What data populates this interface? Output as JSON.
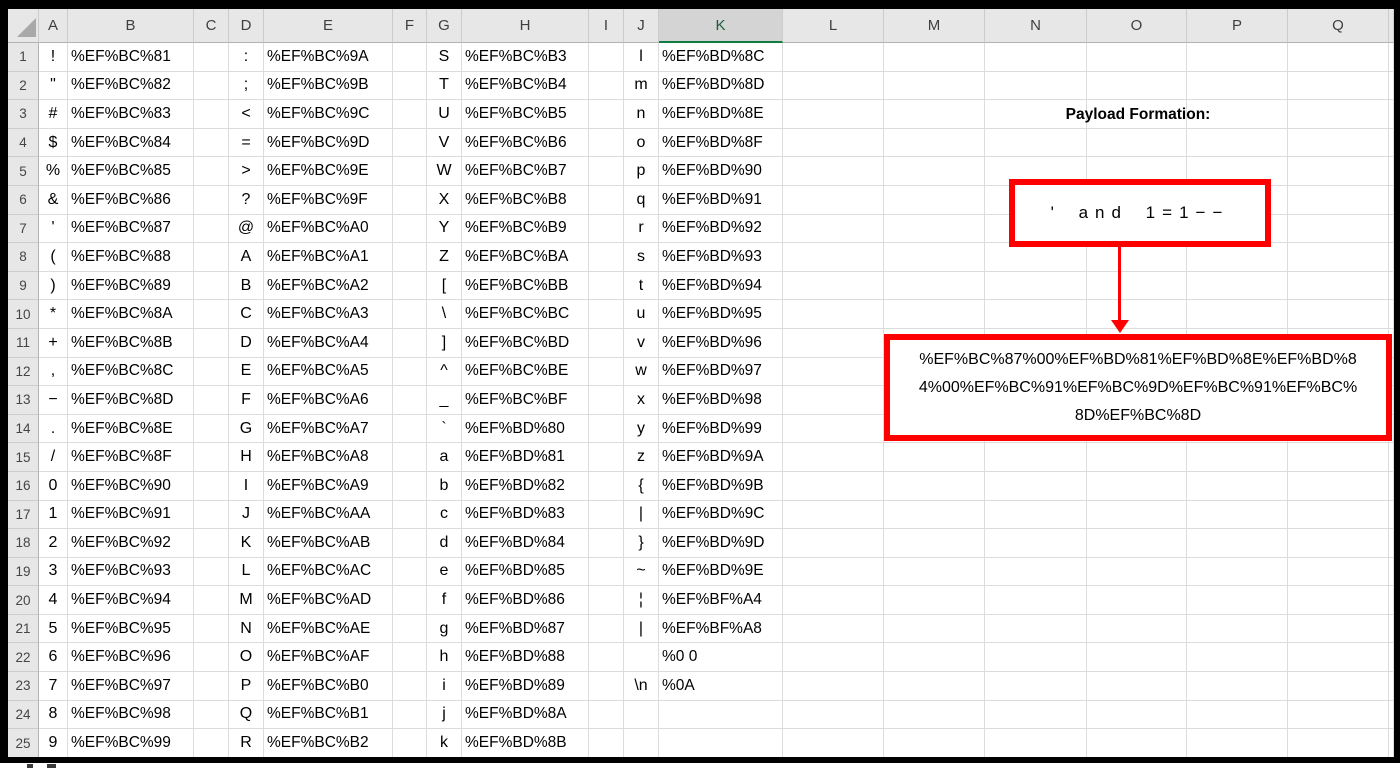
{
  "sheet": {
    "column_headers": [
      "A",
      "B",
      "C",
      "D",
      "E",
      "F",
      "G",
      "H",
      "I",
      "J",
      "K",
      "L",
      "M",
      "N",
      "O",
      "P",
      "Q"
    ],
    "selected_column": "K",
    "rows": [
      {
        "n": "1",
        "a": "!",
        "b": "%EF%BC%81",
        "d": ":",
        "e": "%EF%BC%9A",
        "g": "S",
        "h": "%EF%BC%B3",
        "j": "l",
        "k": "%EF%BD%8C"
      },
      {
        "n": "2",
        "a": "\"",
        "b": "%EF%BC%82",
        "d": ";",
        "e": "%EF%BC%9B",
        "g": "T",
        "h": "%EF%BC%B4",
        "j": "m",
        "k": "%EF%BD%8D"
      },
      {
        "n": "3",
        "a": "#",
        "b": "%EF%BC%83",
        "d": "<",
        "e": "%EF%BC%9C",
        "g": "U",
        "h": "%EF%BC%B5",
        "j": "n",
        "k": "%EF%BD%8E"
      },
      {
        "n": "4",
        "a": "$",
        "b": "%EF%BC%84",
        "d": "=",
        "e": "%EF%BC%9D",
        "g": "V",
        "h": "%EF%BC%B6",
        "j": "o",
        "k": "%EF%BD%8F"
      },
      {
        "n": "5",
        "a": "%",
        "b": "%EF%BC%85",
        "d": ">",
        "e": "%EF%BC%9E",
        "g": "W",
        "h": "%EF%BC%B7",
        "j": "p",
        "k": "%EF%BD%90"
      },
      {
        "n": "6",
        "a": "&",
        "b": "%EF%BC%86",
        "d": "?",
        "e": "%EF%BC%9F",
        "g": "X",
        "h": "%EF%BC%B8",
        "j": "q",
        "k": "%EF%BD%91"
      },
      {
        "n": "7",
        "a": "'",
        "b": "%EF%BC%87",
        "d": "@",
        "e": "%EF%BC%A0",
        "g": "Y",
        "h": "%EF%BC%B9",
        "j": "r",
        "k": "%EF%BD%92"
      },
      {
        "n": "8",
        "a": "(",
        "b": "%EF%BC%88",
        "d": "A",
        "e": "%EF%BC%A1",
        "g": "Z",
        "h": "%EF%BC%BA",
        "j": "s",
        "k": "%EF%BD%93"
      },
      {
        "n": "9",
        "a": ")",
        "b": "%EF%BC%89",
        "d": "B",
        "e": "%EF%BC%A2",
        "g": "[",
        "h": "%EF%BC%BB",
        "j": "t",
        "k": "%EF%BD%94"
      },
      {
        "n": "10",
        "a": "*",
        "b": "%EF%BC%8A",
        "d": "C",
        "e": "%EF%BC%A3",
        "g": "\\",
        "h": "%EF%BC%BC",
        "j": "u",
        "k": "%EF%BD%95"
      },
      {
        "n": "11",
        "a": "+",
        "b": "%EF%BC%8B",
        "d": "D",
        "e": "%EF%BC%A4",
        "g": "]",
        "h": "%EF%BC%BD",
        "j": "v",
        "k": "%EF%BD%96"
      },
      {
        "n": "12",
        "a": ",",
        "b": "%EF%BC%8C",
        "d": "E",
        "e": "%EF%BC%A5",
        "g": "^",
        "h": "%EF%BC%BE",
        "j": "w",
        "k": "%EF%BD%97"
      },
      {
        "n": "13",
        "a": "−",
        "b": "%EF%BC%8D",
        "d": "F",
        "e": "%EF%BC%A6",
        "g": "_",
        "h": "%EF%BC%BF",
        "j": "x",
        "k": "%EF%BD%98"
      },
      {
        "n": "14",
        "a": ".",
        "b": "%EF%BC%8E",
        "d": "G",
        "e": "%EF%BC%A7",
        "g": "`",
        "h": "%EF%BD%80",
        "j": "y",
        "k": "%EF%BD%99"
      },
      {
        "n": "15",
        "a": "/",
        "b": "%EF%BC%8F",
        "d": "H",
        "e": "%EF%BC%A8",
        "g": "a",
        "h": "%EF%BD%81",
        "j": "z",
        "k": "%EF%BD%9A"
      },
      {
        "n": "16",
        "a": "0",
        "b": "%EF%BC%90",
        "d": "I",
        "e": "%EF%BC%A9",
        "g": "b",
        "h": "%EF%BD%82",
        "j": "{",
        "k": "%EF%BD%9B"
      },
      {
        "n": "17",
        "a": "1",
        "b": "%EF%BC%91",
        "d": "J",
        "e": "%EF%BC%AA",
        "g": "c",
        "h": "%EF%BD%83",
        "j": "|",
        "k": "%EF%BD%9C"
      },
      {
        "n": "18",
        "a": "2",
        "b": "%EF%BC%92",
        "d": "K",
        "e": "%EF%BC%AB",
        "g": "d",
        "h": "%EF%BD%84",
        "j": "}",
        "k": "%EF%BD%9D"
      },
      {
        "n": "19",
        "a": "3",
        "b": "%EF%BC%93",
        "d": "L",
        "e": "%EF%BC%AC",
        "g": "e",
        "h": "%EF%BD%85",
        "j": "~",
        "k": "%EF%BD%9E"
      },
      {
        "n": "20",
        "a": "4",
        "b": "%EF%BC%94",
        "d": "M",
        "e": "%EF%BC%AD",
        "g": "f",
        "h": "%EF%BD%86",
        "j": "¦",
        "k": "%EF%BF%A4"
      },
      {
        "n": "21",
        "a": "5",
        "b": "%EF%BC%95",
        "d": "N",
        "e": "%EF%BC%AE",
        "g": "g",
        "h": "%EF%BD%87",
        "j": "|",
        "k": "%EF%BF%A8"
      },
      {
        "n": "22",
        "a": "6",
        "b": "%EF%BC%96",
        "d": "O",
        "e": "%EF%BC%AF",
        "g": "h",
        "h": "%EF%BD%88",
        "j": "",
        "k": "%0 0"
      },
      {
        "n": "23",
        "a": "7",
        "b": "%EF%BC%97",
        "d": "P",
        "e": "%EF%BC%B0",
        "g": "i",
        "h": "%EF%BD%89",
        "j": "\\n",
        "k": "%0A"
      },
      {
        "n": "24",
        "a": "8",
        "b": "%EF%BC%98",
        "d": "Q",
        "e": "%EF%BC%B1",
        "g": "j",
        "h": "%EF%BD%8A",
        "j": "",
        "k": ""
      },
      {
        "n": "25",
        "a": "9",
        "b": "%EF%BC%99",
        "d": "R",
        "e": "%EF%BC%B2",
        "g": "k",
        "h": "%EF%BD%8B",
        "j": "",
        "k": ""
      }
    ]
  },
  "annotation": {
    "title": "Payload Formation:",
    "box1_text": "' and 1=1−−",
    "payload_lines": [
      "%EF%BC%87%00%EF%BD%81%EF%BD%8E%EF%BD%8",
      "4%00%EF%BC%91%EF%BC%9D%EF%BC%91%EF%BC%",
      "8D%EF%BC%8D"
    ],
    "payload_full": "%EF%BC%87%00%EF%BD%81%EF%BD%8E%EF%BD%84%00%EF%BC%91%EF%BC%9D%EF%BC%91%EF%BC%8D%EF%BC%8D",
    "colors": {
      "shape_red": "#ff0000",
      "selected_header_green": "#107c41"
    }
  }
}
